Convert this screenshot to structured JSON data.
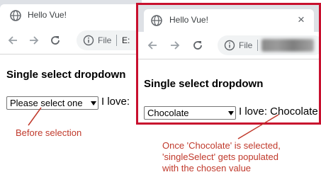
{
  "before": {
    "tab_title": "Hello Vue!",
    "address_scheme": "File",
    "address_text": "E:",
    "heading": "Single select dropdown",
    "select_value": "Please select one",
    "love_text": "I love:"
  },
  "after": {
    "tab_title": "Hello Vue!",
    "close_glyph": "×",
    "address_scheme": "File",
    "heading": "Single select dropdown",
    "select_value": "Chocolate",
    "love_text": "I love: Chocolate"
  },
  "annotations": {
    "before_caption": "Before selection",
    "after_caption_lines": [
      "Once 'Chocolate' is selected,",
      "'singleSelect' gets populated",
      "with the chosen value"
    ]
  },
  "colors": {
    "annotation": "#c0392b",
    "frame": "#c8102e"
  },
  "icons": [
    "globe-icon",
    "back-arrow-icon",
    "forward-arrow-icon",
    "reload-icon",
    "info-icon",
    "close-icon",
    "chevron-down-icon"
  ]
}
